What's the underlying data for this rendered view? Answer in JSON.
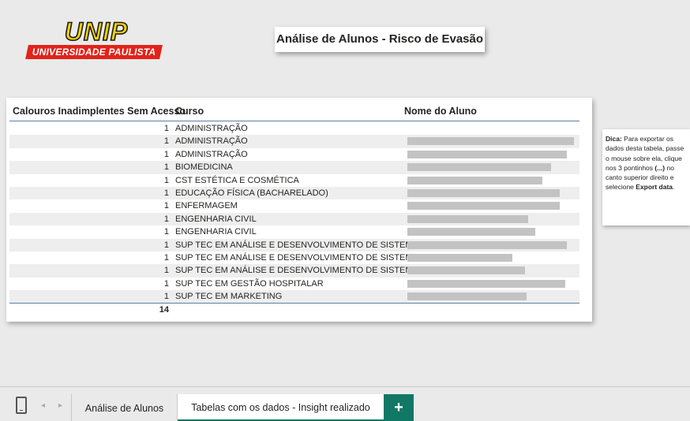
{
  "logo": {
    "wordmark": "UNIP",
    "band_text": "UNIVERSIDADE PAULISTA",
    "colors": {
      "yellow": "#f5d400",
      "red": "#e2231a"
    }
  },
  "title": "Análise de Alunos - Risco de Evasão",
  "table": {
    "headers": {
      "count": "Calouros Inadimplentes Sem Acesso",
      "curso": "Curso",
      "nome": "Nome do Aluno"
    },
    "rows": [
      {
        "count": "1",
        "curso": "ADMINISTRAÇÃO",
        "nome_redacted_fraction": 0.0
      },
      {
        "count": "1",
        "curso": "ADMINISTRAÇÃO",
        "nome_redacted_fraction": 0.95
      },
      {
        "count": "1",
        "curso": "ADMINISTRAÇÃO",
        "nome_redacted_fraction": 0.91
      },
      {
        "count": "1",
        "curso": "BIOMEDICINA",
        "nome_redacted_fraction": 0.82
      },
      {
        "count": "1",
        "curso": "CST ESTÉTICA E COSMÉTICA",
        "nome_redacted_fraction": 0.77
      },
      {
        "count": "1",
        "curso": "EDUCAÇÃO FÍSICA (BACHARELADO)",
        "nome_redacted_fraction": 0.87
      },
      {
        "count": "1",
        "curso": "ENFERMAGEM",
        "nome_redacted_fraction": 0.87
      },
      {
        "count": "1",
        "curso": "ENGENHARIA CIVIL",
        "nome_redacted_fraction": 0.69
      },
      {
        "count": "1",
        "curso": "ENGENHARIA CIVIL",
        "nome_redacted_fraction": 0.73
      },
      {
        "count": "1",
        "curso": "SUP TEC EM ANÁLISE E DESENVOLVIMENTO DE SISTEMAS",
        "nome_redacted_fraction": 0.91
      },
      {
        "count": "1",
        "curso": "SUP TEC EM ANÁLISE E DESENVOLVIMENTO DE SISTEMAS",
        "nome_redacted_fraction": 0.6
      },
      {
        "count": "1",
        "curso": "SUP TEC EM ANÁLISE E DESENVOLVIMENTO DE SISTEMAS",
        "nome_redacted_fraction": 0.67
      },
      {
        "count": "1",
        "curso": "SUP TEC EM GESTÃO HOSPITALAR",
        "nome_redacted_fraction": 0.9
      },
      {
        "count": "1",
        "curso": "SUP TEC EM MARKETING",
        "nome_redacted_fraction": 0.68
      }
    ],
    "total": "14"
  },
  "tip": {
    "label": "Dica:",
    "text_1": " Para exportar os dados desta tabela, passe o mouse sobre ela, clique nos 3 pontinhos ",
    "dots": "(...)",
    "text_2": " no canto superior direito e selecione ",
    "action": "Export data",
    "end": "."
  },
  "tabs": [
    {
      "label": "Análise de Alunos",
      "active": false
    },
    {
      "label": "Tabelas com os dados - Insight realizado",
      "active": true
    }
  ],
  "add_tab_label": "+",
  "nav": {
    "prev": "◂",
    "next": "▸"
  },
  "accent_color": "#117865"
}
